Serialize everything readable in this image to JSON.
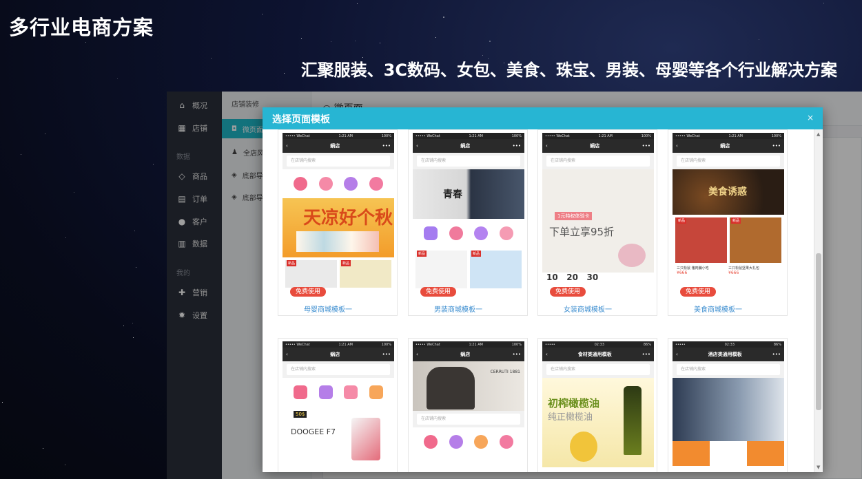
{
  "page": {
    "title": "多行业电商方案",
    "subtitle": "汇聚服装、3C数码、女包、美食、珠宝、男装、母婴等各个行业解决方案"
  },
  "sidebar": {
    "items": [
      {
        "label": "概况"
      },
      {
        "label": "店铺"
      },
      {
        "label": "商品"
      },
      {
        "label": "订单"
      },
      {
        "label": "客户"
      },
      {
        "label": "数据"
      },
      {
        "label": "营销"
      },
      {
        "label": "设置"
      }
    ],
    "sections": [
      "数据",
      "我的"
    ]
  },
  "submenu": {
    "title": "店铺装修",
    "items": [
      {
        "label": "微页面"
      },
      {
        "label": "全店风格"
      },
      {
        "label": "底部导航"
      },
      {
        "label": "底部导航"
      }
    ]
  },
  "content": {
    "title": "微页面"
  },
  "modal": {
    "title": "选择页面模板",
    "close": "×",
    "scroll_up": "▲",
    "scroll_down": "▼",
    "badge_label": "免费使用",
    "templates": [
      {
        "name": "母婴商城模板一",
        "nav_title": "蜗店",
        "search": "在店铺内搜索",
        "time": "1:21 AM",
        "battery": "100%",
        "carrier": "••••• WeChat"
      },
      {
        "name": "男装商城模板一",
        "nav_title": "蜗店",
        "search": "在店铺内搜索",
        "time": "1:21 AM",
        "battery": "100%",
        "carrier": "••••• WeChat",
        "banner_text": "青春"
      },
      {
        "name": "女装商城模板一",
        "nav_title": "蜗店",
        "search": "在店铺内搜索",
        "time": "1:21 AM",
        "battery": "100%",
        "carrier": "••••• WeChat",
        "banner_text": "下单立享95折",
        "banner_sub": "1元特权体验卡"
      },
      {
        "name": "美食商城模板一",
        "nav_title": "蜗店",
        "search": "在店铺内搜索",
        "time": "1:21 AM",
        "battery": "100%",
        "carrier": "••••• WeChat",
        "banner_text": "美食诱惑",
        "product1": "三只松鼠 猪肉脯小吃",
        "product2": "三只松鼠坚果大礼包",
        "price": "¥666"
      },
      {
        "nav_title": "蜗店",
        "search": "在店铺内搜索",
        "time": "1:21 AM",
        "battery": "100%",
        "carrier": "••••• WeChat",
        "banner_text": "DOOGEE F7",
        "price_tag": "50$"
      },
      {
        "nav_title": "蜗店",
        "search": "在店铺内搜索",
        "time": "1:21 AM",
        "battery": "100%",
        "carrier": "••••• WeChat",
        "banner_text": "CERRUTI 1881"
      },
      {
        "nav_title": "食材类通用模板",
        "search": "在店铺内搜索",
        "time": "02:33",
        "battery": "86%",
        "carrier": "•••••",
        "banner_text": "初榨橄榄油",
        "banner_sub": "纯正橄榄油"
      },
      {
        "nav_title": "酒店类通用模板",
        "search": "在店铺内搜索",
        "time": "02:33",
        "battery": "86%",
        "carrier": "•••••"
      }
    ]
  },
  "colors": {
    "accent": "#27b5d3",
    "badge": "#e84c3d",
    "link": "#3a8ccf",
    "sidebar_bg": "#2b2f3a"
  }
}
